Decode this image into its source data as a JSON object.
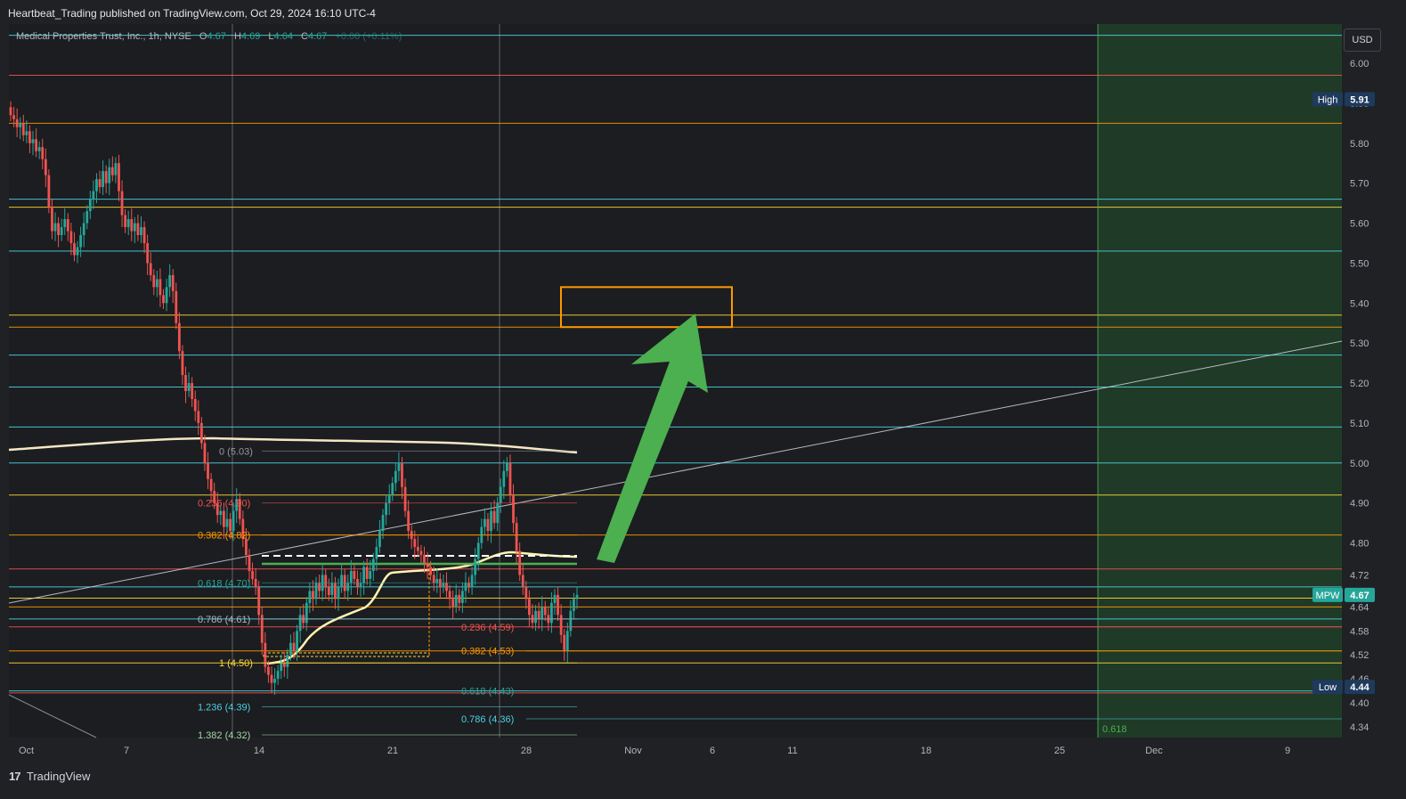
{
  "header": {
    "publisher": "Heartbeat_Trading published on TradingView.com, Oct 29, 2024 16:10 UTC-4"
  },
  "legend": {
    "symbol": "Medical Properties Trust, Inc., 1h, NYSE",
    "o_label": "O",
    "o_value": "4.67",
    "h_label": "H",
    "h_value": "4.69",
    "l_label": "L",
    "l_value": "4.64",
    "c_label": "C",
    "c_value": "4.67",
    "change": "+0.00 (+0.11%)"
  },
  "currency": "USD",
  "footer": {
    "logo": "17",
    "brand": "TradingView"
  },
  "colors": {
    "background": "#1f2124",
    "up": "#26a69a",
    "down": "#ef5350",
    "arrow": "#4caf50",
    "target_box": "#ff9800",
    "projection_zone": "#1f3a27"
  },
  "chart_data": {
    "type": "candlestick",
    "symbol": "MPW",
    "interval": "1h",
    "ylim": [
      4.31,
      6.09
    ],
    "price_ticks": [
      "6.00",
      "5.90",
      "5.80",
      "5.70",
      "5.60",
      "5.50",
      "5.40",
      "5.30",
      "5.20",
      "5.10",
      "5.00",
      "4.90",
      "4.80",
      "4.72",
      "4.64",
      "4.58",
      "4.52",
      "4.46",
      "4.40",
      "4.34"
    ],
    "x_ticks": [
      "Oct",
      "7",
      "14",
      "21",
      "28",
      "Nov",
      "6",
      "11",
      "18",
      "25",
      "Dec",
      "9"
    ],
    "price_badges": [
      {
        "label": "High",
        "value": "5.91",
        "price": 5.91
      },
      {
        "label": "MPW",
        "value": "4.67",
        "price": 4.67
      },
      {
        "label": "Low",
        "value": "4.44",
        "price": 4.44
      }
    ],
    "horizontal_levels": [
      {
        "price": 6.07,
        "color": "#4dd0e1"
      },
      {
        "price": 5.97,
        "color": "#ef5350"
      },
      {
        "price": 5.85,
        "color": "#ff9800"
      },
      {
        "price": 5.66,
        "color": "#4dd0e1"
      },
      {
        "price": 5.64,
        "color": "#fdd835"
      },
      {
        "price": 5.53,
        "color": "#4dd0e1"
      },
      {
        "price": 5.37,
        "color": "#fdd835"
      },
      {
        "price": 5.34,
        "color": "#ff9800"
      },
      {
        "price": 5.27,
        "color": "#4dd0e1"
      },
      {
        "price": 5.19,
        "color": "#4dd0e1"
      },
      {
        "price": 5.09,
        "color": "#4dd0e1"
      },
      {
        "price": 5.0,
        "color": "#4dd0e1"
      },
      {
        "price": 4.92,
        "color": "#fdd835"
      },
      {
        "price": 4.82,
        "color": "#ff9800"
      },
      {
        "price": 4.735,
        "color": "#ef5350"
      },
      {
        "price": 4.69,
        "color": "#4dd0e1"
      },
      {
        "price": 4.662,
        "color": "#fdd835"
      },
      {
        "price": 4.64,
        "color": "#ff9800"
      },
      {
        "price": 4.61,
        "color": "#4dd0e1"
      },
      {
        "price": 4.59,
        "color": "#ef5350"
      },
      {
        "price": 4.53,
        "color": "#ff9800"
      },
      {
        "price": 4.5,
        "color": "#fdd835"
      },
      {
        "price": 4.43,
        "color": "#4dd0e1"
      },
      {
        "price": 4.425,
        "color": "#ef5350"
      }
    ],
    "fib_set_1": [
      {
        "label": "0 (5.03)",
        "price": 5.03,
        "color": "#9598a1"
      },
      {
        "label": "0.236 (4.90)",
        "price": 4.9,
        "color": "#ef5350"
      },
      {
        "label": "0.382 (4.82)",
        "price": 4.82,
        "color": "#ff9800"
      },
      {
        "label": "0.618 (4.70)",
        "price": 4.7,
        "color": "#26a69a"
      },
      {
        "label": "0.786 (4.61)",
        "price": 4.61,
        "color": "#b2b5be"
      },
      {
        "label": "1 (4.50)",
        "price": 4.5,
        "color": "#fdd835"
      },
      {
        "label": "1.236 (4.39)",
        "price": 4.39,
        "color": "#4dd0e1"
      },
      {
        "label": "1.382 (4.32)",
        "price": 4.32,
        "color": "#a5d6a7"
      }
    ],
    "fib_set_2": [
      {
        "label": "0.236 (4.59)",
        "price": 4.59,
        "color": "#ef5350"
      },
      {
        "label": "0.382 (4.53)",
        "price": 4.53,
        "color": "#ff9800"
      },
      {
        "label": "0.618 (4.43)",
        "price": 4.43,
        "color": "#26a69a"
      },
      {
        "label": "0.786 (4.36)",
        "price": 4.36,
        "color": "#4dd0e1"
      }
    ],
    "time_fib_label": "0.618",
    "target_zone": {
      "price_low": 5.34,
      "price_high": 5.44
    },
    "candles_close": [
      5.87,
      5.86,
      5.84,
      5.85,
      5.82,
      5.83,
      5.8,
      5.81,
      5.78,
      5.79,
      5.76,
      5.72,
      5.64,
      5.58,
      5.6,
      5.57,
      5.59,
      5.61,
      5.58,
      5.55,
      5.52,
      5.54,
      5.57,
      5.6,
      5.63,
      5.66,
      5.68,
      5.71,
      5.69,
      5.73,
      5.7,
      5.74,
      5.72,
      5.75,
      5.68,
      5.62,
      5.59,
      5.61,
      5.58,
      5.6,
      5.57,
      5.59,
      5.55,
      5.5,
      5.47,
      5.44,
      5.46,
      5.42,
      5.4,
      5.44,
      5.47,
      5.43,
      5.35,
      5.28,
      5.22,
      5.18,
      5.2,
      5.16,
      5.13,
      5.1,
      5.05,
      5.0,
      4.96,
      4.93,
      4.9,
      4.87,
      4.88,
      4.84,
      4.86,
      4.83,
      4.88,
      4.91,
      4.86,
      4.81,
      4.77,
      4.73,
      4.71,
      4.69,
      4.62,
      4.55,
      4.49,
      4.47,
      4.45,
      4.46,
      4.48,
      4.5,
      4.49,
      4.52,
      4.55,
      4.53,
      4.58,
      4.62,
      4.6,
      4.65,
      4.68,
      4.66,
      4.7,
      4.68,
      4.72,
      4.69,
      4.67,
      4.7,
      4.66,
      4.69,
      4.72,
      4.68,
      4.7,
      4.73,
      4.71,
      4.69,
      4.7,
      4.74,
      4.71,
      4.73,
      4.76,
      4.79,
      4.83,
      4.87,
      4.9,
      4.92,
      4.95,
      4.98,
      5.0,
      4.94,
      4.88,
      4.83,
      4.81,
      4.79,
      4.78,
      4.77,
      4.75,
      4.74,
      4.72,
      4.7,
      4.71,
      4.69,
      4.7,
      4.68,
      4.66,
      4.64,
      4.67,
      4.65,
      4.68,
      4.7,
      4.69,
      4.72,
      4.76,
      4.8,
      4.84,
      4.86,
      4.83,
      4.88,
      4.85,
      4.9,
      4.94,
      4.98,
      5.0,
      4.92,
      4.85,
      4.78,
      4.72,
      4.69,
      4.66,
      4.62,
      4.6,
      4.63,
      4.61,
      4.64,
      4.62,
      4.6,
      4.65,
      4.67,
      4.62,
      4.57,
      4.53,
      4.58,
      4.63,
      4.66,
      4.67
    ]
  }
}
